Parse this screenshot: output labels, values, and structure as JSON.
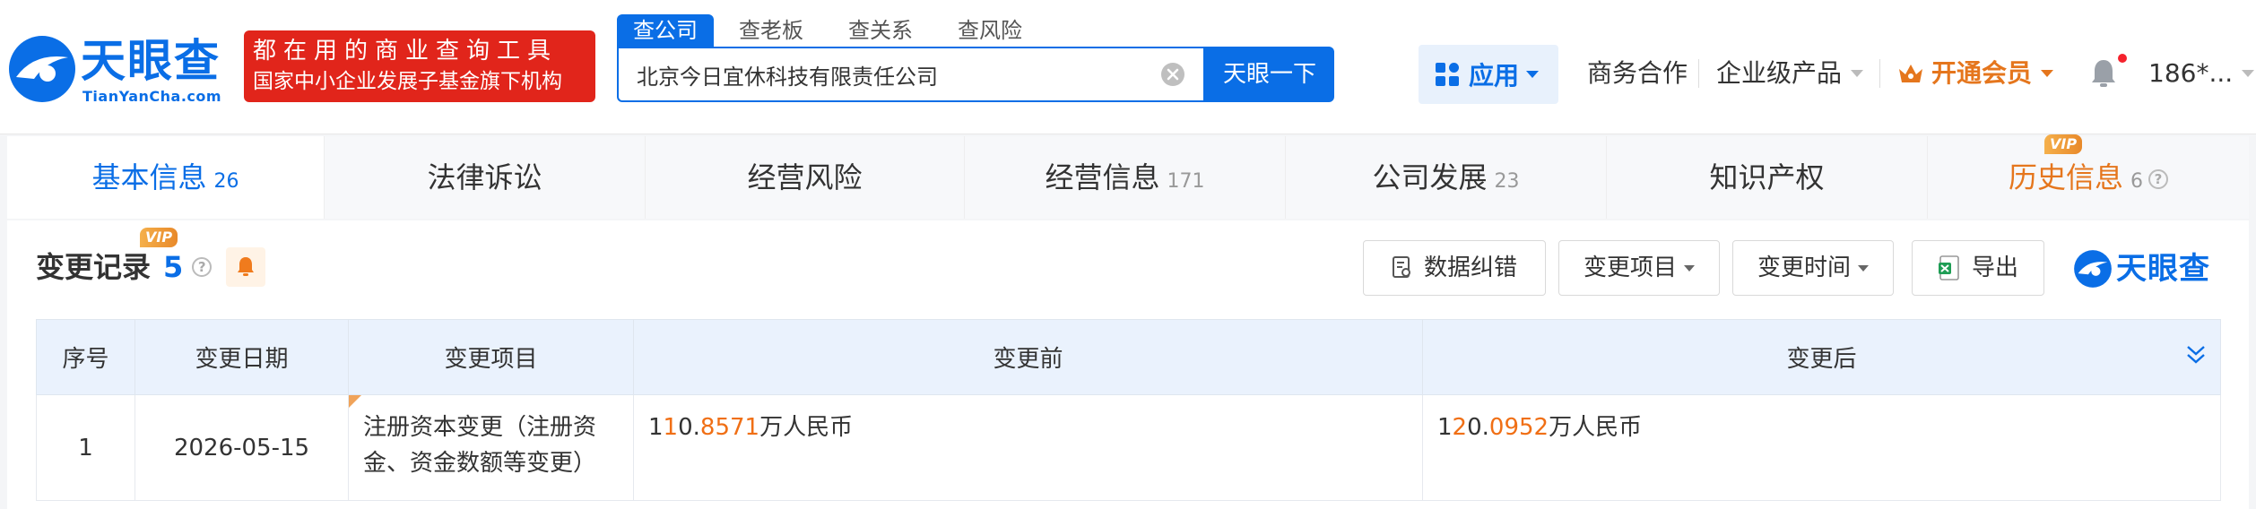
{
  "header": {
    "logo": {
      "name": "天眼查",
      "domain": "TianYanCha.com"
    },
    "slogan": {
      "line1": "都在用的商业查询工具",
      "line2": "国家中小企业发展子基金旗下机构"
    },
    "search_tabs": [
      "查公司",
      "查老板",
      "查关系",
      "查风险"
    ],
    "search": {
      "value": "北京今日宜休科技有限责任公司",
      "button": "天眼一下"
    },
    "nav": {
      "apps": "应用",
      "business": "商务合作",
      "enterprise": "企业级产品",
      "vip": "开通会员",
      "user": "186*..."
    }
  },
  "tabs": [
    {
      "label": "基本信息",
      "count": "26"
    },
    {
      "label": "法律诉讼",
      "count": ""
    },
    {
      "label": "经营风险",
      "count": ""
    },
    {
      "label": "经营信息",
      "count": "171"
    },
    {
      "label": "公司发展",
      "count": "23"
    },
    {
      "label": "知识产权",
      "count": ""
    },
    {
      "label": "历史信息",
      "count": "6",
      "badge": "VIP"
    }
  ],
  "section": {
    "title": "变更记录",
    "count": "5",
    "badge": "VIP",
    "buttons": {
      "correct": "数据纠错",
      "item": "变更项目",
      "time": "变更时间",
      "export": "导出"
    },
    "brand": "天眼查"
  },
  "table": {
    "headers": [
      "序号",
      "变更日期",
      "变更项目",
      "变更前",
      "变更后"
    ],
    "rows": [
      {
        "index": "1",
        "date": "2026-05-15",
        "item": "注册资本变更（注册资金、资金数额等变更）",
        "before": {
          "pre": "1",
          "mid": "1",
          "plain": "0.",
          "hl": "8571",
          "unit": "万人民币"
        },
        "after": {
          "pre": "1",
          "mid": "2",
          "plain": "0.",
          "hl": "0952",
          "unit": "万人民币"
        }
      }
    ]
  },
  "colors": {
    "brand": "#0a6ee6",
    "slogan_bg": "#e1251b",
    "vip": "#e5761d",
    "highlight": "#f06f15"
  }
}
